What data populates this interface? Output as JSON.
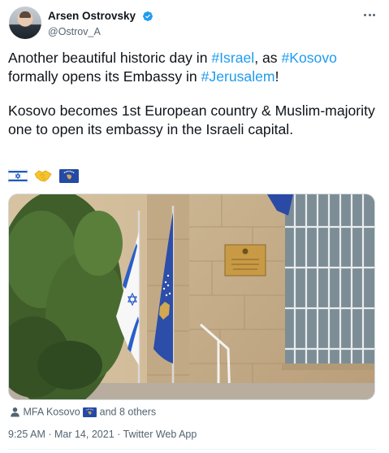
{
  "author": {
    "display_name": "Arsen Ostrovsky",
    "handle": "@Ostrov_A",
    "verified": true
  },
  "tweet": {
    "p1_before_israel": "Another beautiful historic day in ",
    "hashtag_israel": "#Israel",
    "p1_between": ", as ",
    "hashtag_kosovo": "#Kosovo",
    "p1_after_kosovo": " formally opens its Embassy in ",
    "hashtag_jerusalem": "#Jerusalem",
    "p1_end": "!",
    "paragraph2": "Kosovo becomes 1st European country & Muslim-majority one to open its embassy in the Israeli capital.",
    "emojis": [
      "flag-israel-icon",
      "handshake-icon",
      "flag-kosovo-icon"
    ]
  },
  "media": {
    "alt": "Israeli and Kosovo flags outside the Kosovo embassy building in Jerusalem"
  },
  "tagged": {
    "first": "MFA Kosovo",
    "rest": "and 8 others"
  },
  "meta": {
    "time": "9:25 AM",
    "date": "Mar 14, 2021",
    "source": "Twitter Web App",
    "separator": " · "
  },
  "colors": {
    "link": "#1d9bf0",
    "secondary_text": "#536471",
    "primary_text": "#0f1419",
    "verified": "#1d9bf0"
  }
}
